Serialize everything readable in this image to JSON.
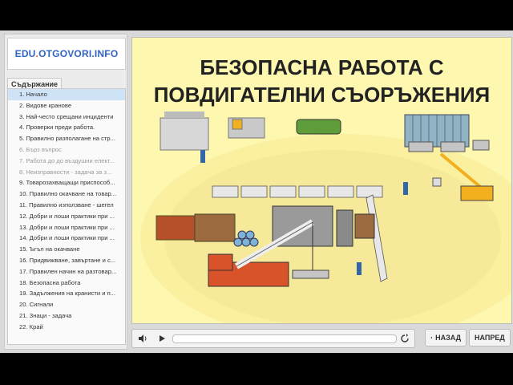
{
  "logo": {
    "text_a": "EDU",
    "text_dot": ".",
    "text_b": "OTGOVORI.INFO"
  },
  "sidebar": {
    "tab_label": "Съдържание",
    "items": [
      {
        "label": "1. Начало",
        "state": "active"
      },
      {
        "label": "2. Видове кранове",
        "state": "normal"
      },
      {
        "label": "3. Най-често срещани инциденти",
        "state": "normal"
      },
      {
        "label": "4. Проверки преди работа.",
        "state": "normal"
      },
      {
        "label": "5. Правилно разполагане на стр...",
        "state": "normal"
      },
      {
        "label": "6. Бърз въпрос",
        "state": "dim"
      },
      {
        "label": "7. Работа до до въздушни елект...",
        "state": "dim"
      },
      {
        "label": "8. Неизправности - задача за з...",
        "state": "dim"
      },
      {
        "label": "9. Товарозахващащи приспособ...",
        "state": "normal"
      },
      {
        "label": "10. Правилно окачване на товар...",
        "state": "normal"
      },
      {
        "label": "11. Правилно използване - шегел",
        "state": "normal"
      },
      {
        "label": "12. Добри и лоши практики при ...",
        "state": "normal"
      },
      {
        "label": "13. Добри и лоши практики при ...",
        "state": "normal"
      },
      {
        "label": "14. Добри и лоши практики при ...",
        "state": "normal"
      },
      {
        "label": "15. Ъгъл на окачване",
        "state": "normal"
      },
      {
        "label": "16. Придвижване, завъртане и с...",
        "state": "normal"
      },
      {
        "label": "17. Правилен начин на разтовар...",
        "state": "normal"
      },
      {
        "label": "18. Безопасна работа",
        "state": "normal"
      },
      {
        "label": "19. Задължения на кранисти и п...",
        "state": "normal"
      },
      {
        "label": "20. Сигнали",
        "state": "normal"
      },
      {
        "label": "21. Знаци - задача",
        "state": "normal"
      },
      {
        "label": "22. Край",
        "state": "normal"
      }
    ]
  },
  "slide": {
    "title_line1": "БЕЗОПАСНА РАБОТА С",
    "title_line2": "ПОВДИГАТЕЛНИ СЪОРЪЖЕНИЯ"
  },
  "player": {
    "volume_icon": "speaker-icon",
    "play_icon": "play-icon",
    "replay_icon": "replay-icon",
    "progress": 0.0
  },
  "nav": {
    "back_label": "НАЗАД",
    "next_label": "НАПРЕД"
  },
  "colors": {
    "accent": "#2f63c4",
    "stage_bg": "#fdf7b0",
    "active_item": "#cfe3f7"
  }
}
